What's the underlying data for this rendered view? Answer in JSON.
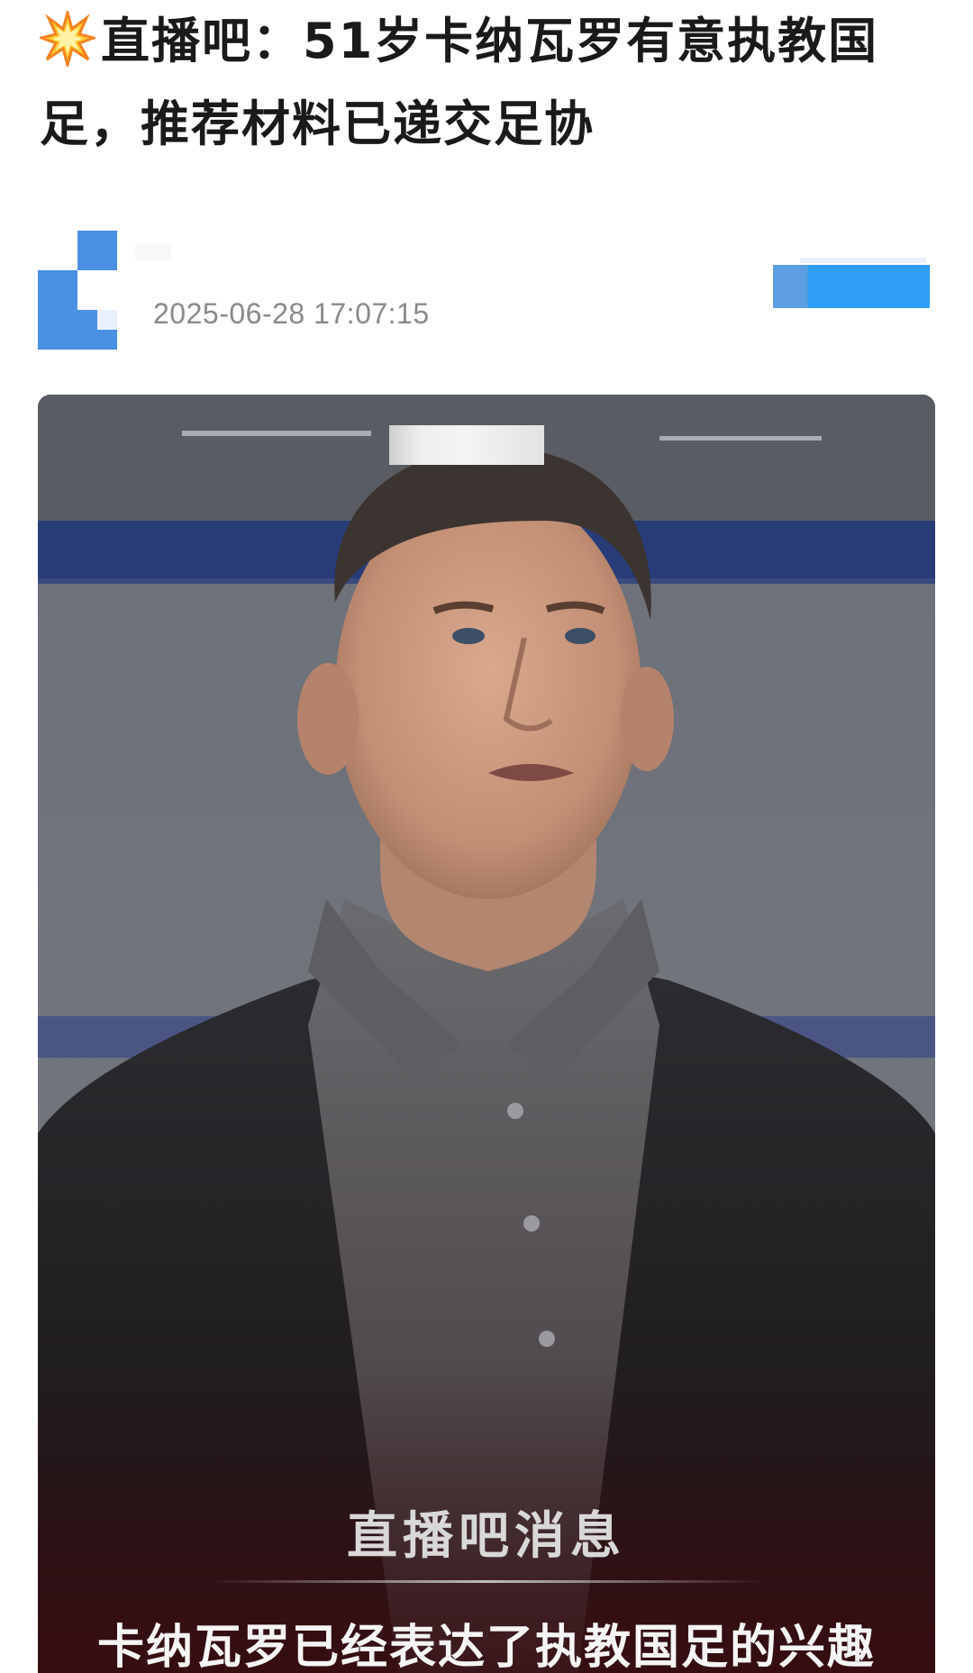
{
  "article": {
    "headline": "直播吧：51岁卡纳瓦罗有意执教国足，推荐材料已递交足协",
    "headline_icon": "collision-burst-icon"
  },
  "author": {
    "avatar_icon": "author-avatar-logo",
    "publish_time": "2025-06-28 17:07:15",
    "follow_label": "",
    "accent_color": "#2f9cf5"
  },
  "photo": {
    "overlay_title": "直播吧消息",
    "overlay_caption": "卡纳瓦罗已经表达了执教国足的兴趣"
  }
}
